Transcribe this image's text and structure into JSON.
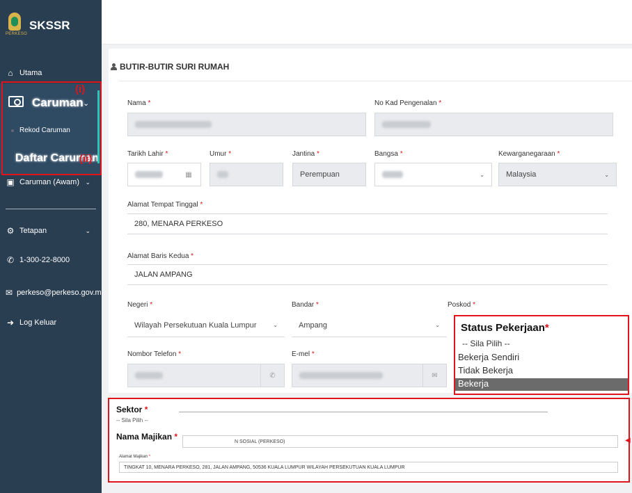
{
  "app": {
    "name": "SKSSR",
    "logo_sub": "PERKESO"
  },
  "sidebar": {
    "items": [
      {
        "label": "Utama"
      },
      {
        "label": "Caruman"
      },
      {
        "label": "Rekod Caruman"
      },
      {
        "label": "Daftar Caruman"
      },
      {
        "label": "Caruman (Awam)"
      },
      {
        "label": "Tetapan"
      },
      {
        "label": "1-300-22-8000"
      },
      {
        "label": "perkeso@perkeso.gov.my"
      },
      {
        "label": "Log Keluar"
      }
    ],
    "markers": {
      "one": "(i)",
      "two": "(ii)"
    }
  },
  "form": {
    "title": "BUTIR-BUTIR SURI RUMAH",
    "labels": {
      "nama": "Nama",
      "no_kad": "No Kad Pengenalan",
      "tarikh_lahir": "Tarikh Lahir",
      "umur": "Umur",
      "jantina": "Jantina",
      "bangsa": "Bangsa",
      "kewarganegaraan": "Kewarganegaraan",
      "alamat1": "Alamat Tempat Tinggal",
      "alamat2": "Alamat Baris Kedua",
      "negeri": "Negeri",
      "bandar": "Bandar",
      "poskod": "Poskod",
      "telefon": "Nombor Telefon",
      "emel": "E-mel"
    },
    "required_mark": "*",
    "values": {
      "jantina": "Perempuan",
      "kewarganegaraan": "Malaysia",
      "alamat1": "280, MENARA PERKESO",
      "alamat2": "JALAN AMPANG",
      "negeri": "Wilayah Persekutuan Kuala Lumpur",
      "bandar": "Ampang"
    }
  },
  "status_pekerjaan": {
    "title": "Status Pekerjaan",
    "options": [
      "-- Sila Pilih --",
      "Bekerja Sendiri",
      "Tidak Bekerja",
      "Bekerja"
    ],
    "selected": "Bekerja"
  },
  "sektor": {
    "label": "Sektor",
    "value": "-- Sila Pilih --",
    "majikan_label": "Nama Majikan",
    "majikan_value": "N SOSIAL (PERKESO)",
    "alamat_label": "Alamat Majikan",
    "alamat_value": "TINGKAT 10, MENARA PERKESO, 281, JALAN AMPANG,  50536 KUALA LUMPUR WILAYAH PERSEKUTUAN KUALA LUMPUR"
  },
  "colors": {
    "sidebar": "#2a3e52",
    "annotation": "#e0141a",
    "accent": "#2ec4b6"
  },
  "icons": [
    "home-icon",
    "wallet-icon",
    "chevron-down-icon",
    "gear-icon",
    "phone-icon",
    "mail-icon",
    "logout-icon",
    "calendar-icon",
    "user-icon"
  ]
}
